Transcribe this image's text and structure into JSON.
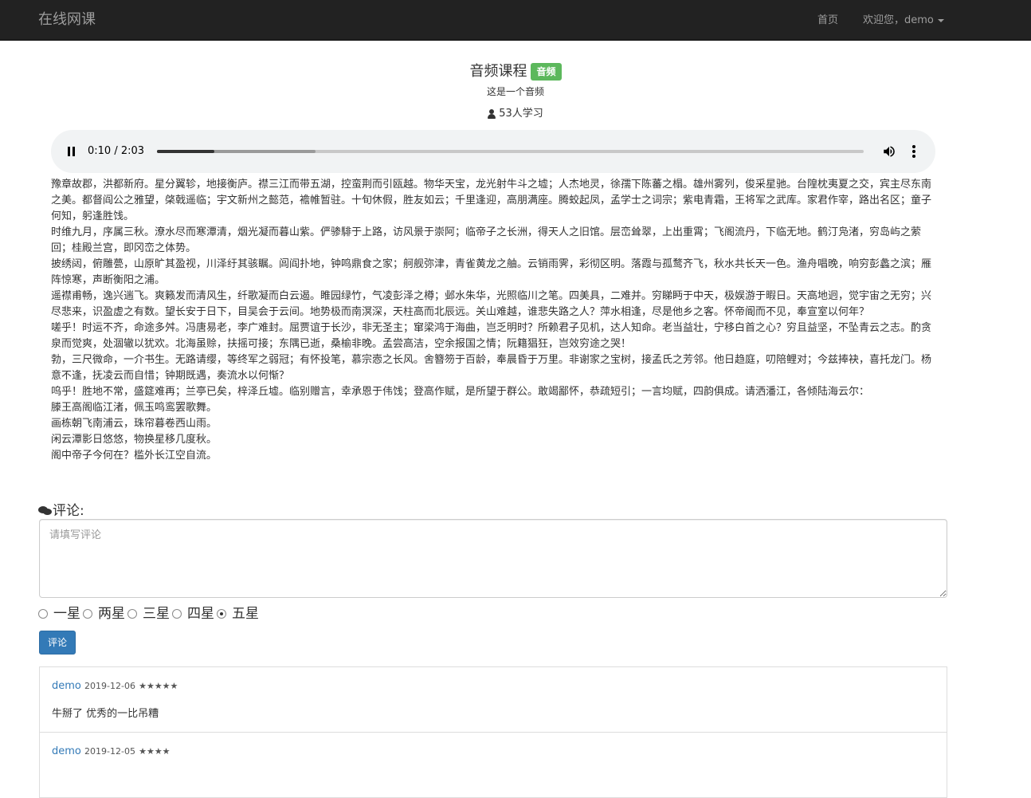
{
  "navbar": {
    "brand": "在线网课",
    "home": "首页",
    "user": "欢迎您，demo"
  },
  "course": {
    "title": "音频课程",
    "badge": "音频",
    "description": "这是一个音频",
    "learners": "53人学习"
  },
  "player": {
    "time": "0:10 / 2:03",
    "progress": 0.0813,
    "buffered": 0.224
  },
  "content": [
    "豫章故郡，洪都新府。星分翼轸，地接衡庐。襟三江而带五湖，控蛮荆而引瓯越。物华天宝，龙光射牛斗之墟；人杰地灵，徐孺下陈蕃之榻。雄州雾列，俊采星驰。台隍枕夷夏之交，宾主尽东南之美。都督阎公之雅望，棨戟遥临；宇文新州之懿范，襜帷暂驻。十旬休假，胜友如云；千里逢迎，高朋满座。腾蛟起凤，孟学士之词宗；紫电青霜，王将军之武库。家君作宰，路出名区；童子何知，躬逢胜饯。",
    "时维九月，序属三秋。潦水尽而寒潭清，烟光凝而暮山紫。俨骖騑于上路，访风景于崇阿；临帝子之长洲，得天人之旧馆。层峦耸翠，上出重霄；飞阁流丹，下临无地。鹤汀凫渚，穷岛屿之萦回；桂殿兰宫，即冈峦之体势。",
    "披绣闼，俯雕甍，山原旷其盈视，川泽纡其骇瞩。闾阎扑地，钟鸣鼎食之家；舸舰弥津，青雀黄龙之舳。云销雨霁，彩彻区明。落霞与孤鹜齐飞，秋水共长天一色。渔舟唱晚，响穷彭蠡之滨；雁阵惊寒，声断衡阳之浦。",
    "遥襟甫畅，逸兴遄飞。爽籁发而清风生，纤歌凝而白云遏。睢园绿竹，气凌彭泽之樽；邺水朱华，光照临川之笔。四美具，二难并。穷睇眄于中天，极娱游于暇日。天高地迥，觉宇宙之无穷；兴尽悲来，识盈虚之有数。望长安于日下，目吴会于云间。地势极而南溟深，天柱高而北辰远。关山难越，谁悲失路之人？萍水相逢，尽是他乡之客。怀帝阍而不见，奉宣室以何年？",
    "嗟乎！时运不齐，命途多舛。冯唐易老，李广难封。屈贾谊于长沙，非无圣主；窜梁鸿于海曲，岂乏明时？所赖君子见机，达人知命。老当益壮，宁移白首之心？穷且益坚，不坠青云之志。酌贪泉而觉爽，处涸辙以犹欢。北海虽赊，扶摇可接；东隅已逝，桑榆非晚。孟尝高洁，空余报国之情；阮籍猖狂，岂效穷途之哭！",
    "勃，三尺微命，一介书生。无路请缨，等终军之弱冠；有怀投笔，慕宗悫之长风。舍簪笏于百龄，奉晨昏于万里。非谢家之宝树，接孟氏之芳邻。他日趋庭，叨陪鲤对；今兹捧袂，喜托龙门。杨意不逢，抚凌云而自惜；钟期既遇，奏流水以何惭？",
    "呜乎！胜地不常，盛筵难再；兰亭已矣，梓泽丘墟。临别赠言，幸承恩于伟饯；登高作赋，是所望于群公。敢竭鄙怀，恭疏短引；一言均赋，四韵俱成。请洒潘江，各倾陆海云尔：",
    "滕王高阁临江渚，佩玉鸣鸾罢歌舞。",
    "画栋朝飞南浦云，珠帘暮卷西山雨。",
    "闲云潭影日悠悠，物换星移几度秋。",
    "阁中帝子今何在？槛外长江空自流。"
  ],
  "comment_form": {
    "label": "评论:",
    "placeholder": "请填写评论",
    "ratings": [
      "一星",
      "两星",
      "三星",
      "四星",
      "五星"
    ],
    "selected_rating": "五星",
    "submit": "评论"
  },
  "comments": [
    {
      "user": "demo",
      "date": "2019-12-06",
      "stars": "★★★★★",
      "text": "牛掰了 优秀的一比吊糟"
    },
    {
      "user": "demo",
      "date": "2019-12-05",
      "stars": "★★★★",
      "text": ""
    }
  ],
  "colors": {
    "navbar_bg": "#222222",
    "badge": "#5cb85c",
    "primary": "#337ab7"
  }
}
